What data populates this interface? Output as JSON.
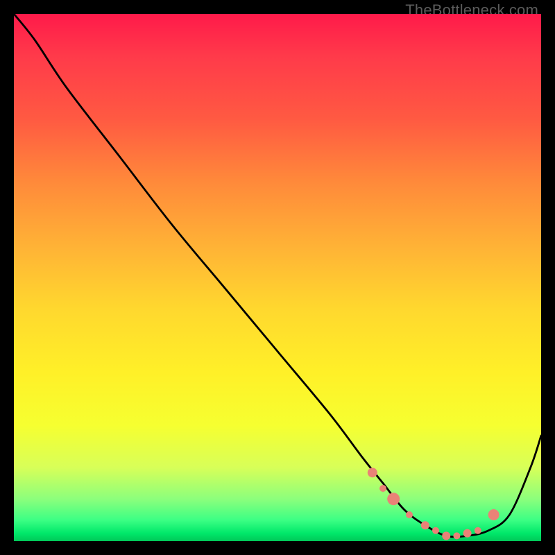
{
  "watermark": "TheBottleneck.com",
  "chart_data": {
    "type": "line",
    "title": "",
    "xlabel": "",
    "ylabel": "",
    "xlim": [
      0,
      100
    ],
    "ylim": [
      0,
      100
    ],
    "series": [
      {
        "name": "bottleneck-curve",
        "x": [
          0,
          4,
          10,
          20,
          30,
          40,
          50,
          60,
          66,
          70,
          74,
          78,
          82,
          86,
          90,
          94,
          98,
          100
        ],
        "values": [
          100,
          95,
          86,
          73,
          60,
          48,
          36,
          24,
          16,
          11,
          6,
          3,
          1,
          1,
          2,
          5,
          14,
          20
        ]
      }
    ],
    "markers": {
      "name": "highlighted-points",
      "color": "#e98277",
      "x": [
        68,
        70,
        72,
        75,
        78,
        80,
        82,
        84,
        86,
        88,
        91
      ],
      "values": [
        13,
        10,
        8,
        5,
        3,
        2,
        1,
        1,
        1.5,
        2,
        5
      ],
      "radius": [
        7,
        5,
        9,
        5,
        6,
        5,
        6,
        5,
        6,
        5,
        8
      ]
    }
  }
}
